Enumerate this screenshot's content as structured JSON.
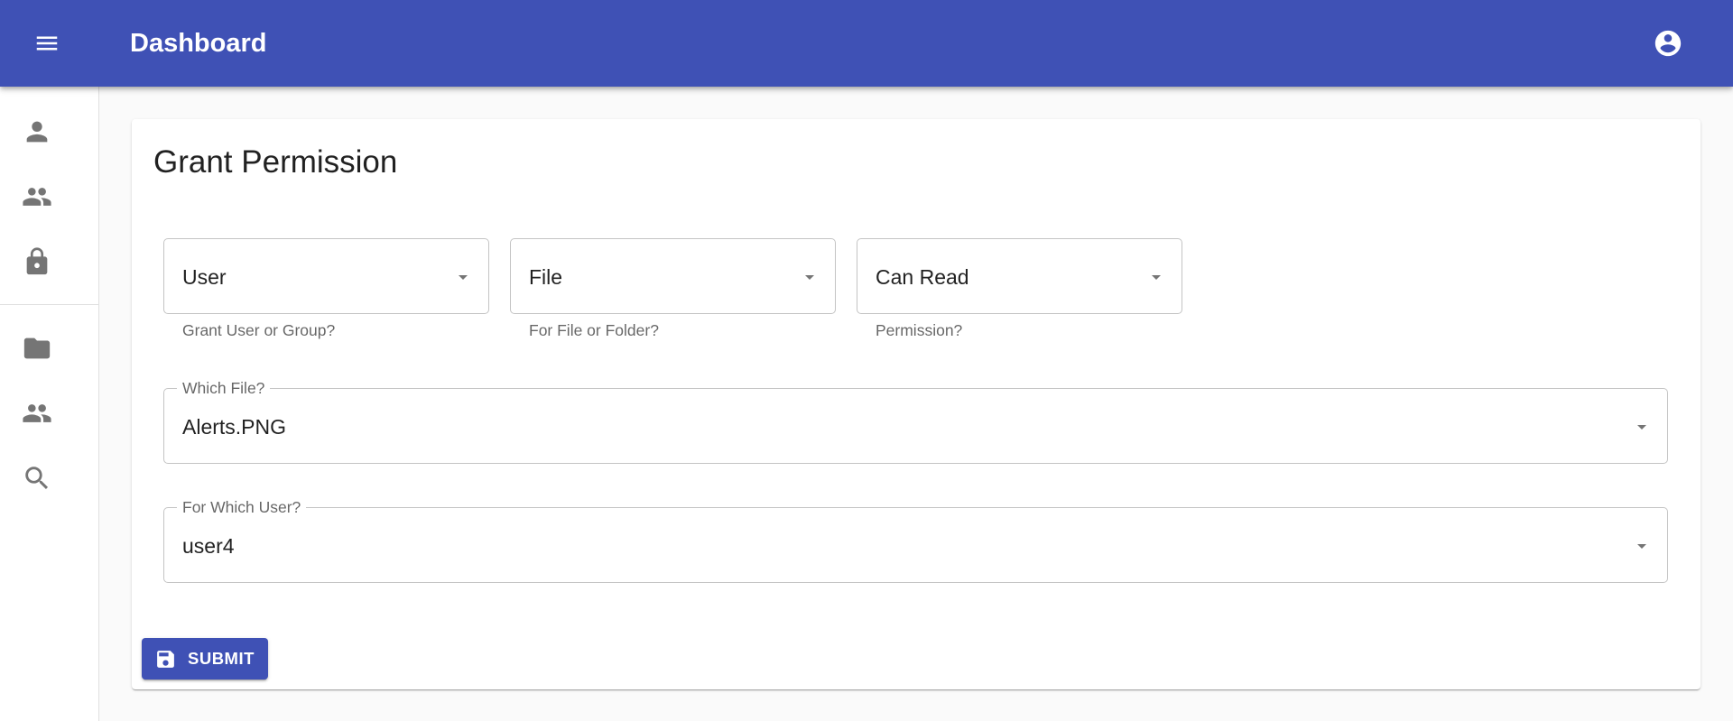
{
  "appbar": {
    "title": "Dashboard",
    "menu_icon": "menu-icon",
    "account_icon": "account-circle-icon"
  },
  "sidebar": {
    "items": [
      {
        "icon": "person-icon"
      },
      {
        "icon": "group-icon"
      },
      {
        "icon": "lock-icon"
      },
      {
        "icon": "folder-icon"
      },
      {
        "icon": "group-icon"
      },
      {
        "icon": "search-icon"
      }
    ]
  },
  "form": {
    "title": "Grant Permission",
    "grantee_type": {
      "value": "User",
      "helper": "Grant User or Group?"
    },
    "target_type": {
      "value": "File",
      "helper": "For File or Folder?"
    },
    "permission": {
      "value": "Can Read",
      "helper": "Permission?"
    },
    "which_file": {
      "label": "Which File?",
      "value": "Alerts.PNG"
    },
    "which_user": {
      "label": "For Which User?",
      "value": "user4"
    },
    "submit_label": "SUBMIT",
    "submit_icon": "save-icon"
  },
  "colors": {
    "primary": "#3f51b5",
    "background": "#fafafa",
    "icon_gray": "#757575"
  }
}
